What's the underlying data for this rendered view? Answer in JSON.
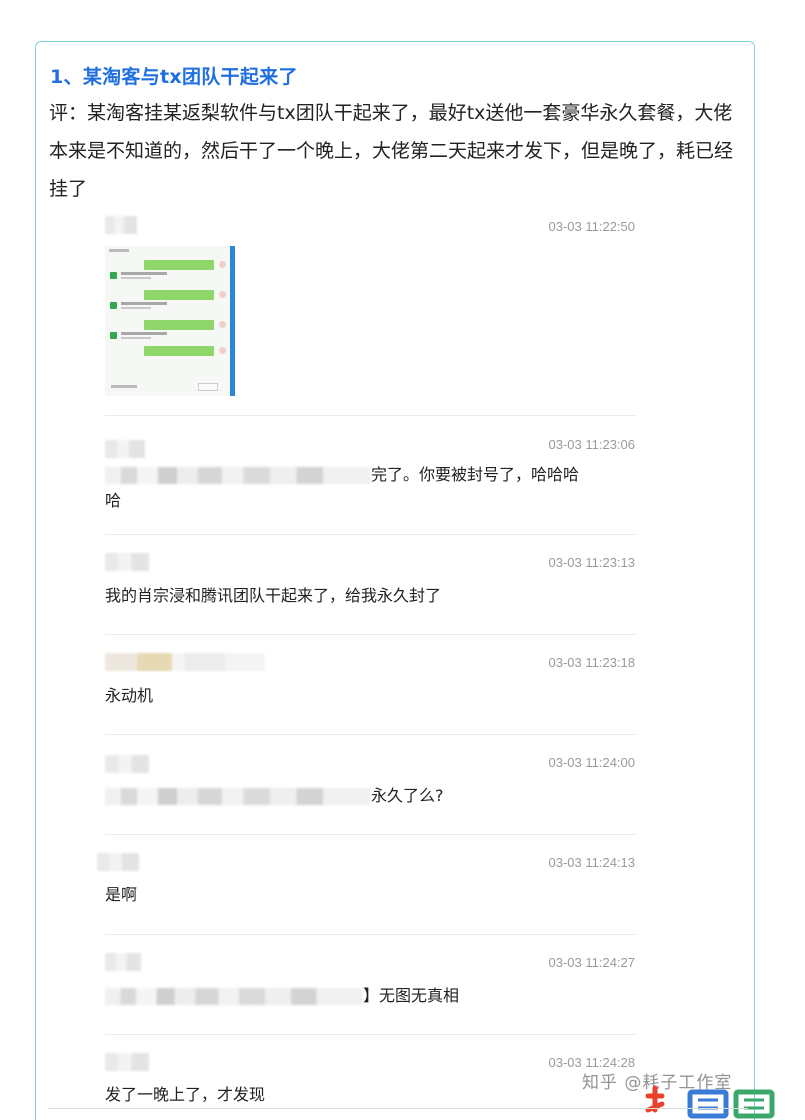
{
  "post": {
    "title": "1、某淘客与tx团队干起来了",
    "comment": "评：某淘客挂某返梨软件与tx团队干起来了，最好tx送他一套豪华永久套餐，大佬本来是不知道的，然后干了一个晚上，大佬第二天起来才发下，但是晚了，耗已经挂了"
  },
  "chat": {
    "messages": [
      {
        "time": "03-03 11:22:50",
        "type": "image"
      },
      {
        "time": "03-03 11:23:06",
        "text_line1_visible": "完了。你要被封号了，哈哈哈",
        "text_line2": "哈"
      },
      {
        "time": "03-03 11:23:13",
        "text": "我的肖宗浸和腾讯团队干起来了，给我永久封了"
      },
      {
        "time": "03-03 11:23:18",
        "text": "永动机"
      },
      {
        "time": "03-03 11:24:00",
        "text_visible": "永久了么?"
      },
      {
        "time": "03-03 11:24:13",
        "text": "是啊"
      },
      {
        "time": "03-03 11:24:27",
        "text_visible": "】无图无真相"
      },
      {
        "time": "03-03 11:24:28",
        "text": "发了一晚上了，才发现"
      }
    ]
  },
  "watermark": {
    "text": "知乎 @耗子工作室",
    "logo_color_primary": "#e8412c",
    "logo_color_secondary": "#3aa86b"
  },
  "colors": {
    "card_border": "#7fd3db",
    "title": "#1f6fe0",
    "timestamp": "#9a9a9a"
  }
}
